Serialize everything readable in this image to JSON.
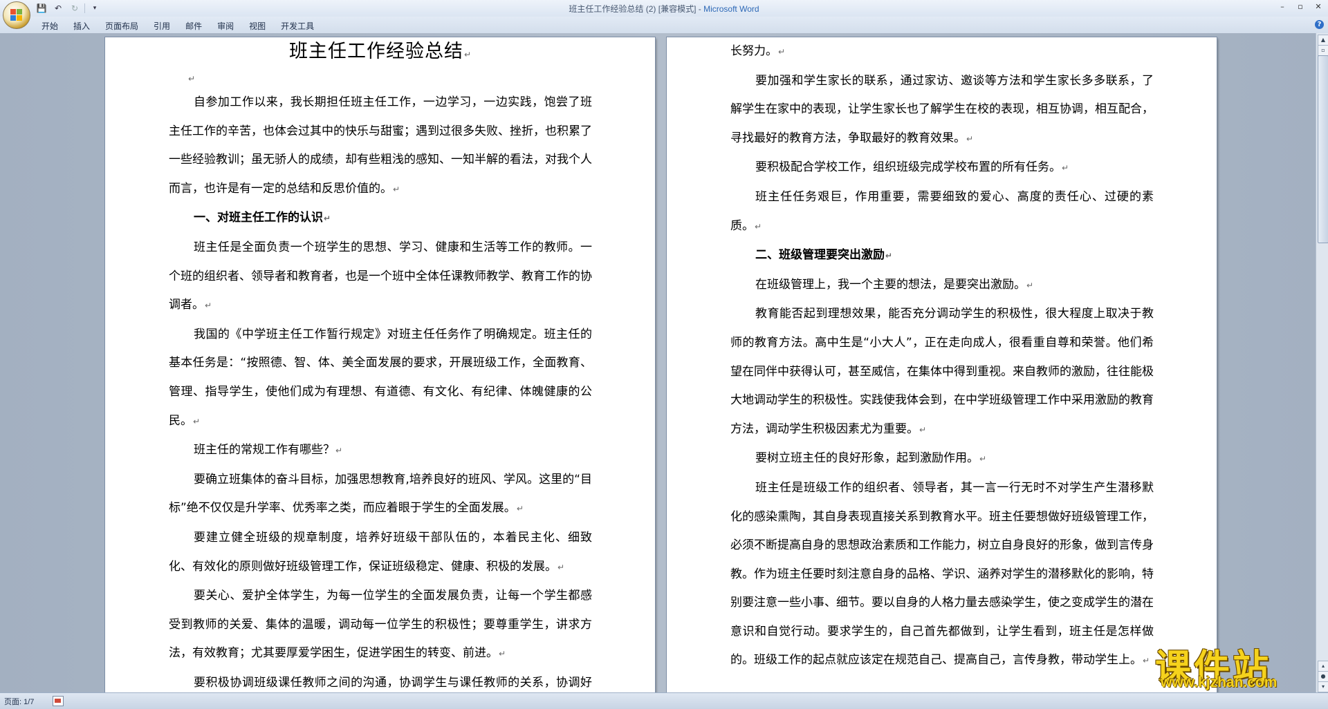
{
  "window": {
    "title": "班主任工作经验总结 (2) [兼容模式] - ",
    "app_name": "Microsoft Word"
  },
  "quick_access": {
    "save_glyph": "💾",
    "undo_glyph": "↶",
    "redo_glyph": "↻",
    "more_glyph": "▾"
  },
  "window_controls": {
    "minimize": "–",
    "maximize": "▫",
    "close": "✕"
  },
  "ribbon": {
    "tabs": [
      "开始",
      "插入",
      "页面布局",
      "引用",
      "邮件",
      "审阅",
      "视图",
      "开发工具"
    ],
    "help": "?"
  },
  "para_mark": "↵",
  "page1": {
    "title": "班主任工作经验总结",
    "blocks": [
      {
        "type": "blank",
        "text": ""
      },
      {
        "type": "p",
        "text": "自参加工作以来，我长期担任班主任工作，一边学习，一边实践，饱尝了班主任工作的辛苦，也体会过其中的快乐与甜蜜；遇到过很多失败、挫折，也积累了一些经验教训；虽无骄人的成绩，却有些粗浅的感知、一知半解的看法，对我个人而言，也许是有一定的总结和反思价值的。"
      },
      {
        "type": "h",
        "text": "一、对班主任工作的认识"
      },
      {
        "type": "p",
        "text": "班主任是全面负责一个班学生的思想、学习、健康和生活等工作的教师。一个班的组织者、领导者和教育者，也是一个班中全体任课教师教学、教育工作的协调者。"
      },
      {
        "type": "p",
        "text": "我国的《中学班主任工作暂行规定》对班主任任务作了明确规定。班主任的基本任务是：“按照德、智、体、美全面发展的要求，开展班级工作，全面教育、管理、指导学生，使他们成为有理想、有道德、有文化、有纪律、体魄健康的公民。"
      },
      {
        "type": "p",
        "text": "班主任的常规工作有哪些？"
      },
      {
        "type": "p",
        "text": "要确立班集体的奋斗目标，加强思想教育,培养良好的班风、学风。这里的“目标”绝不仅仅是升学率、优秀率之类，而应着眼于学生的全面发展。"
      },
      {
        "type": "p",
        "text": "要建立健全班级的规章制度，培养好班级干部队伍的，本着民主化、细致化、有效化的原则做好班级管理工作，保证班级稳定、健康、积极的发展。"
      },
      {
        "type": "p",
        "text": "要关心、爱护全体学生，为每一位学生的全面发展负责，让每一个学生都感受到教师的关爱、集体的温暖，调动每一位学生的积极性；要尊重学生，讲求方法，有效教育；尤其要厚爱学困生，促进学困生的转变、前进。"
      },
      {
        "type": "p",
        "text": "要积极协调班级课任教师之间的沟通，协调学生与课任教师的关系，协调好各科教学工作，形成教育合力，共同做好学生的教育工作，促进学生全面成长。"
      }
    ]
  },
  "page2": {
    "blocks": [
      {
        "type": "cont",
        "text": "长努力。"
      },
      {
        "type": "p",
        "text": "要加强和学生家长的联系，通过家访、邀谈等方法和学生家长多多联系，了解学生在家中的表现，让学生家长也了解学生在校的表现，相互协调，相互配合，寻找最好的教育方法，争取最好的教育效果。"
      },
      {
        "type": "p",
        "text": "要积极配合学校工作，组织班级完成学校布置的所有任务。"
      },
      {
        "type": "p",
        "text": "班主任任务艰巨，作用重要，需要细致的爱心、高度的责任心、过硬的素质。"
      },
      {
        "type": "h",
        "text": "二、班级管理要突出激励"
      },
      {
        "type": "p",
        "text": "在班级管理上，我一个主要的想法，是要突出激励。"
      },
      {
        "type": "p",
        "text": "教育能否起到理想效果，能否充分调动学生的积极性，很大程度上取决于教师的教育方法。高中生是“小大人”，正在走向成人，很看重自尊和荣誉。他们希望在同伴中获得认可，甚至威信，在集体中得到重视。来自教师的激励，往往能极大地调动学生的积极性。实践使我体会到，在中学班级管理工作中采用激励的教育方法，调动学生积极因素尤为重要。"
      },
      {
        "type": "p",
        "text": "要树立班主任的良好形象，起到激励作用。"
      },
      {
        "type": "p",
        "text": "班主任是班级工作的组织者、领导者，其一言一行无时不对学生产生潜移默化的感染熏陶，其自身表现直接关系到教育水平。班主任要想做好班级管理工作，必须不断提高自身的思想政治素质和工作能力，树立自身良好的形象，做到言传身教。作为班主任要时刻注意自身的品格、学识、涵养对学生的潜移默化的影响，特别要注意一些小事、细节。要以自身的人格力量去感染学生，使之变成学生的潜在意识和自觉行动。要求学生的，自己首先都做到，让学生看到，班主任是怎样做的。班级工作的起点就应该定在规范自己、提高自己，言传身教，带动学生上。"
      }
    ]
  },
  "status": {
    "page_info": "页面: 1/7"
  },
  "watermark": {
    "cn": "课件站",
    "url": "www.kjzhan.com"
  },
  "colors": {
    "accent": "#2d68b6",
    "watermark": "#f5d21c"
  }
}
